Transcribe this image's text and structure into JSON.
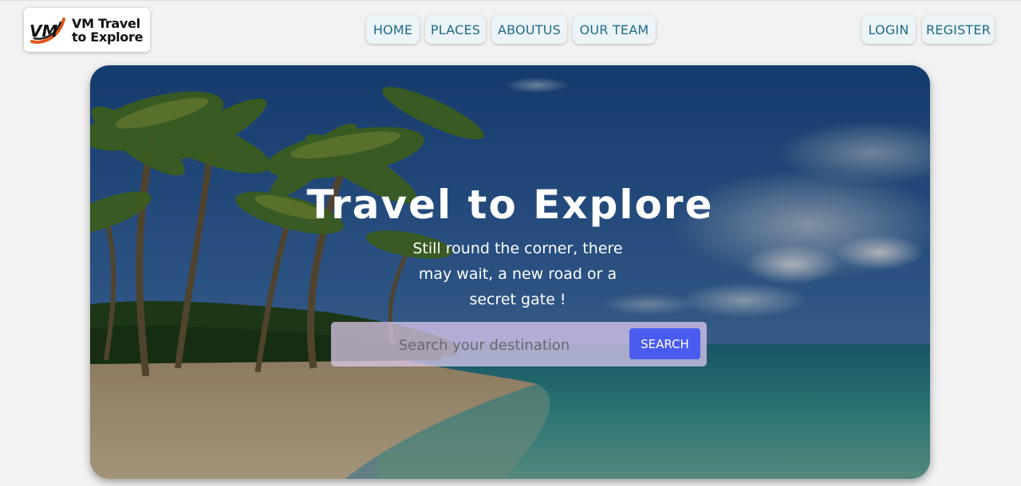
{
  "brand": {
    "mark": "VM",
    "line1": "VM Travel",
    "line2": "to Explore"
  },
  "nav": {
    "items": [
      {
        "label": "HOME"
      },
      {
        "label": "PLACES"
      },
      {
        "label": "ABOUTUS"
      },
      {
        "label": "OUR TEAM"
      }
    ],
    "login_label": "LOGIN",
    "register_label": "REGISTER"
  },
  "hero": {
    "title": "Travel to Explore",
    "subtitle": "Still round the corner, there may wait, a new road or a secret gate !",
    "search_placeholder": "Search your destination",
    "search_value": "",
    "search_button": "SEARCH"
  },
  "colors": {
    "page_bg": "#f2f2f2",
    "nav_text": "#1d6b86",
    "nav_bg": "#edf4f8",
    "search_button": "#4a5cf0",
    "logo_accent": "#e2561f"
  }
}
